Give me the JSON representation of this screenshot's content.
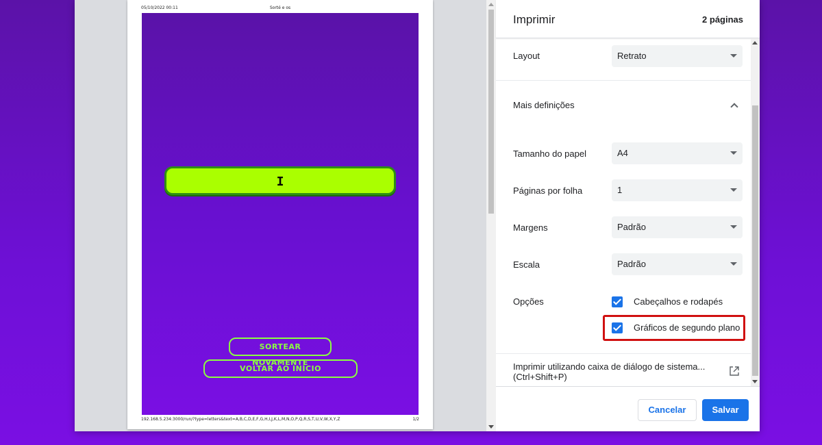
{
  "preview": {
    "header_left": "05/10/2022 00:11",
    "header_center": "Sorté e os",
    "footer_left": "192.168.5.234:3000/run/?type=letters&text=A,B,C,D,E,F,G,H,I,J,K,L,M,N,O,P,Q,R,S,T,U,V,W,X,Y,Z",
    "footer_right": "1/2",
    "result_text": "I",
    "btn_again": "SORTEAR NOVAMENTE",
    "btn_home": "VOLTAR AO INÍCIO"
  },
  "settings": {
    "title": "Imprimir",
    "pages": "2 páginas",
    "layout_label": "Layout",
    "layout_value": "Retrato",
    "more_settings": "Mais definições",
    "paper_label": "Tamanho do papel",
    "paper_value": "A4",
    "per_sheet_label": "Páginas por folha",
    "per_sheet_value": "1",
    "margins_label": "Margens",
    "margins_value": "Padrão",
    "scale_label": "Escala",
    "scale_value": "Padrão",
    "options_label": "Opções",
    "opt_headers": "Cabeçalhos e rodapés",
    "opt_background": "Gráficos de segundo plano",
    "system_dialog": "Imprimir utilizando caixa de diálogo de sistema... (Ctrl+Shift+P)",
    "cancel": "Cancelar",
    "save": "Salvar"
  },
  "colors": {
    "accent": "#1a73e8",
    "highlight": "#d01010",
    "lime": "#aaff00",
    "purple": "#6a10d2"
  }
}
